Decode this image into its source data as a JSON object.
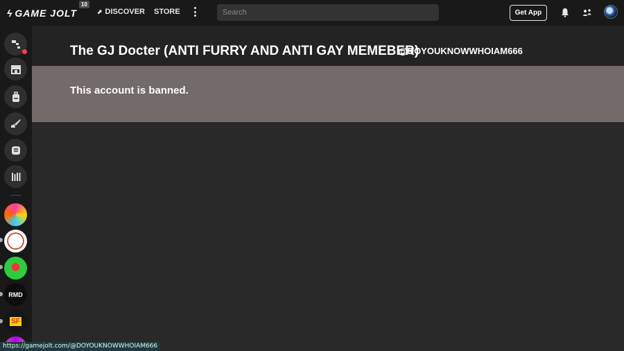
{
  "header": {
    "logo_text": "GAME JOLT",
    "badge_count": "10",
    "nav": {
      "discover": "DISCOVER",
      "store": "STORE"
    },
    "search_placeholder": "Search",
    "get_app_label": "Get App"
  },
  "profile": {
    "display_name": "The GJ Docter (ANTI FURRY AND ANTI GAY MEMEBER)",
    "username": "@DOYOUKNOWWHOIAM666"
  },
  "banned": {
    "message": "This account is banned."
  },
  "sidebar": {
    "items": [
      "activity-icon",
      "store-icon",
      "backpack-icon",
      "creator-icon",
      "chat-icon",
      "library-icon"
    ],
    "communities": [
      {
        "label": ""
      },
      {
        "label": ""
      },
      {
        "label": ""
      },
      {
        "label": "RMD"
      },
      {
        "label": "SF"
      },
      {
        "label": ""
      }
    ]
  },
  "status_bar": {
    "url": "https://gamejolt.com/@DOYOUKNOWWHOIAM666"
  },
  "colors": {
    "topbar": "#191919",
    "main_bg": "#292929",
    "banned_bg": "#736a6a",
    "notification_dot": "#ff3e5b"
  }
}
